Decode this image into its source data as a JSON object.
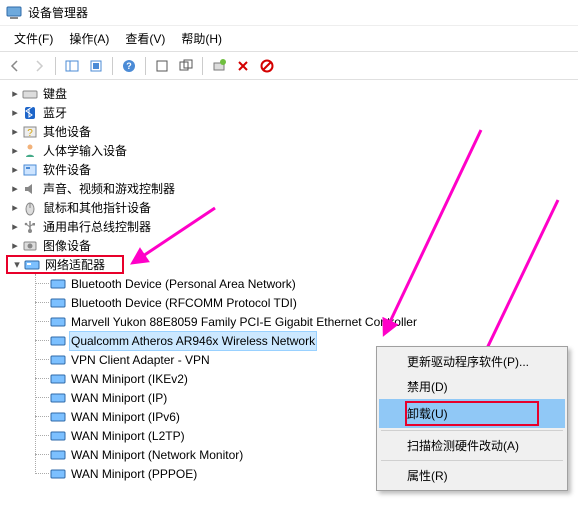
{
  "title": "设备管理器",
  "menu": {
    "file": "文件(F)",
    "action": "操作(A)",
    "view": "查看(V)",
    "help": "帮助(H)"
  },
  "nodes": [
    {
      "icon": "keyboard",
      "label": "键盘"
    },
    {
      "icon": "bluetooth",
      "label": "蓝牙"
    },
    {
      "icon": "other",
      "label": "其他设备"
    },
    {
      "icon": "hid",
      "label": "人体学输入设备"
    },
    {
      "icon": "software",
      "label": "软件设备"
    },
    {
      "icon": "sound",
      "label": "声音、视频和游戏控制器"
    },
    {
      "icon": "mouse",
      "label": "鼠标和其他指针设备"
    },
    {
      "icon": "usb",
      "label": "通用串行总线控制器"
    },
    {
      "icon": "camera",
      "label": "图像设备"
    }
  ],
  "highlightedCategory": {
    "icon": "network",
    "label": "网络适配器"
  },
  "networkChildren": [
    "Bluetooth Device (Personal Area Network)",
    "Bluetooth Device (RFCOMM Protocol TDI)",
    "Marvell Yukon 88E8059 Family PCI-E Gigabit Ethernet Controller",
    "Qualcomm Atheros AR946x Wireless Network",
    "VPN Client Adapter - VPN",
    "WAN Miniport (IKEv2)",
    "WAN Miniport (IP)",
    "WAN Miniport (IPv6)",
    "WAN Miniport (L2TP)",
    "WAN Miniport (Network Monitor)",
    "WAN Miniport (PPPOE)"
  ],
  "selectedChildIndex": 3,
  "contextMenu": {
    "updateDriver": "更新驱动程序软件(P)...",
    "disable": "禁用(D)",
    "uninstall": "卸载(U)",
    "scan": "扫描检测硬件改动(A)",
    "properties": "属性(R)"
  }
}
